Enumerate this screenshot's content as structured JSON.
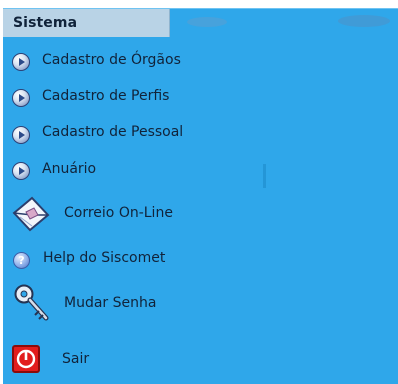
{
  "menu": {
    "title": "Sistema",
    "items": [
      {
        "label": "Cadastro de Órgãos",
        "icon": "arrow-bullet-icon"
      },
      {
        "label": "Cadastro de Perfis",
        "icon": "arrow-bullet-icon"
      },
      {
        "label": "Cadastro de Pessoal",
        "icon": "arrow-bullet-icon"
      },
      {
        "label": "Anuário",
        "icon": "arrow-bullet-icon"
      },
      {
        "label": "Correio On-Line",
        "icon": "mail-envelope-icon"
      },
      {
        "label": "Help do Siscomet",
        "icon": "help-icon"
      },
      {
        "label": "Mudar Senha",
        "icon": "key-icon"
      },
      {
        "label": "Sair",
        "icon": "power-exit-icon"
      }
    ]
  },
  "colors": {
    "panel_background": "#2fa7ea",
    "header_background": "#b9d3e6",
    "text": "#11233a",
    "exit_red": "#e21d1d"
  }
}
